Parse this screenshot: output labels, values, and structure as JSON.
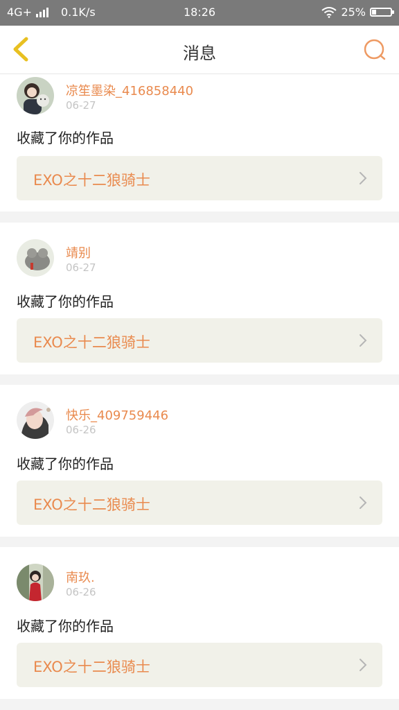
{
  "status_bar": {
    "network": "4G+",
    "speed": "0.1K/s",
    "time": "18:26",
    "battery": "25%",
    "battery_level": 0.25
  },
  "header": {
    "title": "消息",
    "back_icon": "chevron-left-icon",
    "search_icon": "search-icon",
    "accent_color": "#e8c021",
    "search_color": "#ee9a63"
  },
  "messages": [
    {
      "user": "凉笙墨染_416858440",
      "date": "06-27",
      "action": "收藏了你的作品",
      "work_title": "EXO之十二狼骑士"
    },
    {
      "user": "靖别",
      "date": "06-27",
      "action": "收藏了你的作品",
      "work_title": "EXO之十二狼骑士"
    },
    {
      "user": "快乐_409759446",
      "date": "06-26",
      "action": "收藏了你的作品",
      "work_title": "EXO之十二狼骑士"
    },
    {
      "user": "南玖.",
      "date": "06-26",
      "action": "收藏了你的作品",
      "work_title": "EXO之十二狼骑士"
    }
  ],
  "colors": {
    "name": "#e98a4e",
    "date": "#c4c4c4",
    "link_bg": "#f1f1e9",
    "page_bg": "#f3f3f3"
  }
}
